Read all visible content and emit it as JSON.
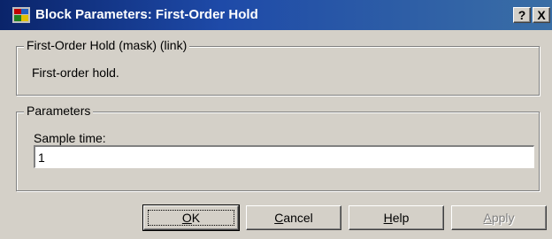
{
  "window": {
    "title": "Block Parameters: First-Order Hold",
    "help_glyph": "?",
    "close_glyph": "X",
    "icon": "simulink-block-icon"
  },
  "mask_group": {
    "legend": "First-Order Hold (mask) (link)",
    "description": "First-order hold."
  },
  "parameters_group": {
    "legend": "Parameters",
    "sample_time_label": "Sample time:",
    "sample_time_value": "1"
  },
  "buttons": {
    "ok": {
      "mnemonic": "O",
      "rest": "K"
    },
    "cancel": {
      "mnemonic": "C",
      "rest": "ancel"
    },
    "help": {
      "mnemonic": "H",
      "rest": "elp"
    },
    "apply": {
      "mnemonic": "A",
      "rest": "pply",
      "enabled": false
    }
  },
  "colors": {
    "titlebar": "#0a246a",
    "face": "#d4d0c8",
    "disabled_text": "#808080"
  }
}
